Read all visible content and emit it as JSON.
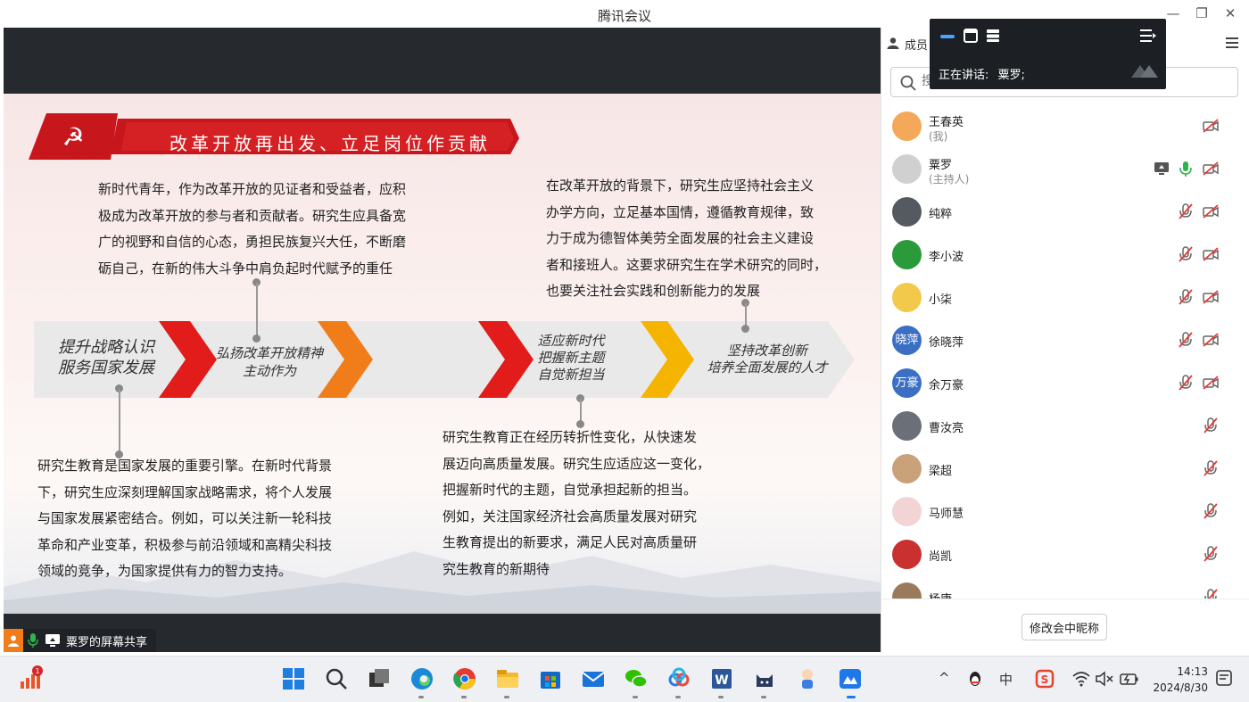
{
  "window": {
    "title": "腾讯会议"
  },
  "slide": {
    "banner": "改革开放再出发、立足岗位作贡献",
    "para_top_left": [
      "新时代青年，作为改革开放的见证者和受益者，应积",
      "极成为改革开放的参与者和贡献者。研究生应具备宽",
      "广的视野和自信的心态，勇担民族复兴大任，不断磨",
      "砺自己，在新的伟大斗争中肩负起时代赋予的重任"
    ],
    "para_top_right": [
      "在改革开放的背景下，研究生应坚持社会主义",
      "办学方向，立足基本国情，遵循教育规律，致",
      "力于成为德智体美劳全面发展的社会主义建设",
      "者和接班人。这要求研究生在学术研究的同时，",
      "也要关注社会实践和创新能力的发展"
    ],
    "stages": [
      {
        "lines": [
          "提升战略认识",
          "服务国家发展"
        ]
      },
      {
        "lines": [
          "弘扬改革开放精神",
          "主动作为"
        ]
      },
      {
        "lines": [
          "适应新时代",
          "把握新主题",
          "自觉新担当"
        ]
      },
      {
        "lines": [
          "坚持改革创新",
          "培养全面发展的人才"
        ]
      }
    ],
    "para_bottom_left": [
      "研究生教育是国家发展的重要引擎。在新时代背景",
      "下，研究生应深刻理解国家战略需求，将个人发展",
      "与国家发展紧密结合。例如，可以关注新一轮科技",
      "革命和产业变革，积极参与前沿领域和高精尖科技",
      "领域的竞争，为国家提供有力的智力支持。"
    ],
    "para_bottom_mid": [
      "研究生教育正在经历转折性变化，从快速发",
      "展迈向高质量发展。研究生应适应这一变化，",
      "把握新时代的主题，自觉承担起新的担当。",
      "例如，关注国家经济社会高质量发展对研究",
      "生教育提出的新要求，满足人民对高质量研",
      "究生教育的新期待"
    ]
  },
  "share_label": "粟罗的屏幕共享",
  "panel": {
    "tab_label": "成员",
    "search_placeholder": "搜",
    "members": [
      {
        "name": "王春英",
        "sub": "(我)",
        "avatar_color": "#f4a85a",
        "avatar_text": "",
        "mic": "none",
        "cam": "off",
        "screen": false
      },
      {
        "name": "粟罗",
        "sub": "(主持人)",
        "avatar_color": "#d0d0d0",
        "avatar_text": "",
        "mic": "on",
        "cam": "off",
        "screen": true
      },
      {
        "name": "纯粹",
        "sub": "",
        "avatar_color": "#555a60",
        "avatar_text": "",
        "mic": "off",
        "cam": "off",
        "screen": false
      },
      {
        "name": "李小波",
        "sub": "",
        "avatar_color": "#2b9a3a",
        "avatar_text": "",
        "mic": "off",
        "cam": "off",
        "screen": false
      },
      {
        "name": "小柒",
        "sub": "",
        "avatar_color": "#f3c94b",
        "avatar_text": "",
        "mic": "off",
        "cam": "off",
        "screen": false
      },
      {
        "name": "徐晓萍",
        "sub": "",
        "avatar_color": "#3a6fc4",
        "avatar_text": "晓萍",
        "mic": "off",
        "cam": "off",
        "screen": false
      },
      {
        "name": "余万豪",
        "sub": "",
        "avatar_color": "#3a6fc4",
        "avatar_text": "万豪",
        "mic": "off",
        "cam": "off",
        "screen": false
      },
      {
        "name": "曹汝亮",
        "sub": "",
        "avatar_color": "#6b6f78",
        "avatar_text": "",
        "mic": "off",
        "cam": "none",
        "screen": false
      },
      {
        "name": "梁超",
        "sub": "",
        "avatar_color": "#c9a27a",
        "avatar_text": "",
        "mic": "off",
        "cam": "none",
        "screen": false
      },
      {
        "name": "马师慧",
        "sub": "",
        "avatar_color": "#f2d4d4",
        "avatar_text": "",
        "mic": "off",
        "cam": "none",
        "screen": false
      },
      {
        "name": "尚凯",
        "sub": "",
        "avatar_color": "#c93030",
        "avatar_text": "",
        "mic": "off",
        "cam": "none",
        "screen": false
      },
      {
        "name": "杨康",
        "sub": "",
        "avatar_color": "#9a7a5a",
        "avatar_text": "",
        "mic": "off",
        "cam": "none",
        "screen": false
      }
    ],
    "rename_button": "修改会中昵称"
  },
  "speaker_overlay": {
    "label": "正在讲话:",
    "name": "粟罗;"
  },
  "taskbar": {
    "badge": "1",
    "time": "14:13",
    "date": "2024/8/30",
    "ime": "中"
  },
  "colors": {
    "accent_red": "#c8161d",
    "mic_green": "#2fb34a",
    "orange": "#f07d1a",
    "yellow": "#f5b400"
  }
}
